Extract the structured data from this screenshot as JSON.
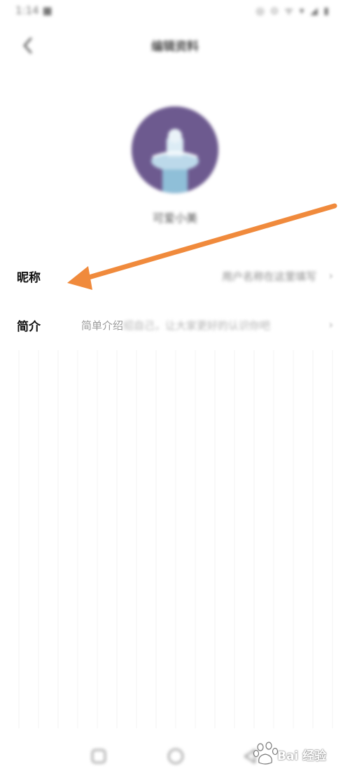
{
  "status_bar": {
    "time": "1:14 ■",
    "icons": "◎ ⊙ ᯤ ▾ ◢ ▮"
  },
  "header": {
    "back_icon": "chevron-left-icon",
    "title": "编辑资料"
  },
  "profile": {
    "avatar_color": "#6d5a8f",
    "name": "可爱小美"
  },
  "rows": {
    "nickname": {
      "label": "昵称",
      "value": "用户名称在这里填写",
      "chevron": "›"
    },
    "bio": {
      "label": "简介",
      "value_clear": "简单介绍",
      "value_faded": "绍自己，让大家更好的认识你吧",
      "chevron": "›"
    }
  },
  "annotation": {
    "arrow_color": "#f08a3c"
  },
  "navbar": {
    "buttons": [
      "square-nav-icon",
      "circle-home-icon",
      "triangle-back-icon"
    ]
  },
  "watermark": {
    "text": "Bai 经验",
    "color": "#ffffff"
  }
}
